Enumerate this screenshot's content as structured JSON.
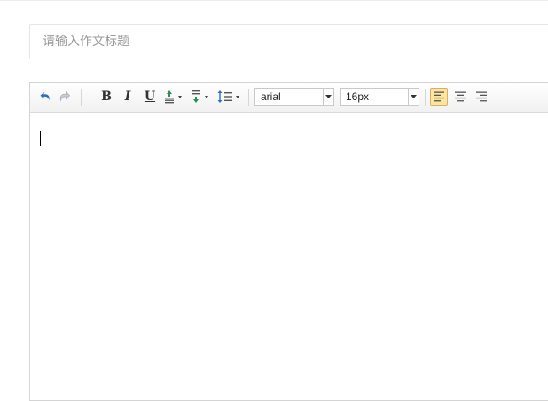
{
  "title": {
    "placeholder": "请输入作文标题",
    "value": ""
  },
  "toolbar": {
    "buttons": [
      {
        "name": "undo",
        "icon": "undo-icon"
      },
      {
        "name": "redo",
        "icon": "redo-icon"
      },
      {
        "name": "bold",
        "icon": "bold-icon",
        "label": "B"
      },
      {
        "name": "italic",
        "icon": "italic-icon",
        "label": "I"
      },
      {
        "name": "underline",
        "icon": "underline-icon",
        "label": "U"
      },
      {
        "name": "font-color",
        "icon": "font-color-icon"
      },
      {
        "name": "paragraph-spacing",
        "icon": "paragraph-spacing-icon"
      },
      {
        "name": "line-height",
        "icon": "line-height-icon"
      },
      {
        "name": "align-left",
        "icon": "align-left-icon",
        "active": true
      },
      {
        "name": "align-center",
        "icon": "align-center-icon"
      },
      {
        "name": "align-right",
        "icon": "align-right-icon"
      }
    ],
    "font_family": "arial",
    "font_size": "16px"
  },
  "editor": {
    "content": ""
  },
  "colors": {
    "active_bg": "#ffe69f",
    "active_border": "#dcac6c",
    "undo_blue": "#2e6fc0",
    "redo_disabled": "#9fb8d8"
  }
}
